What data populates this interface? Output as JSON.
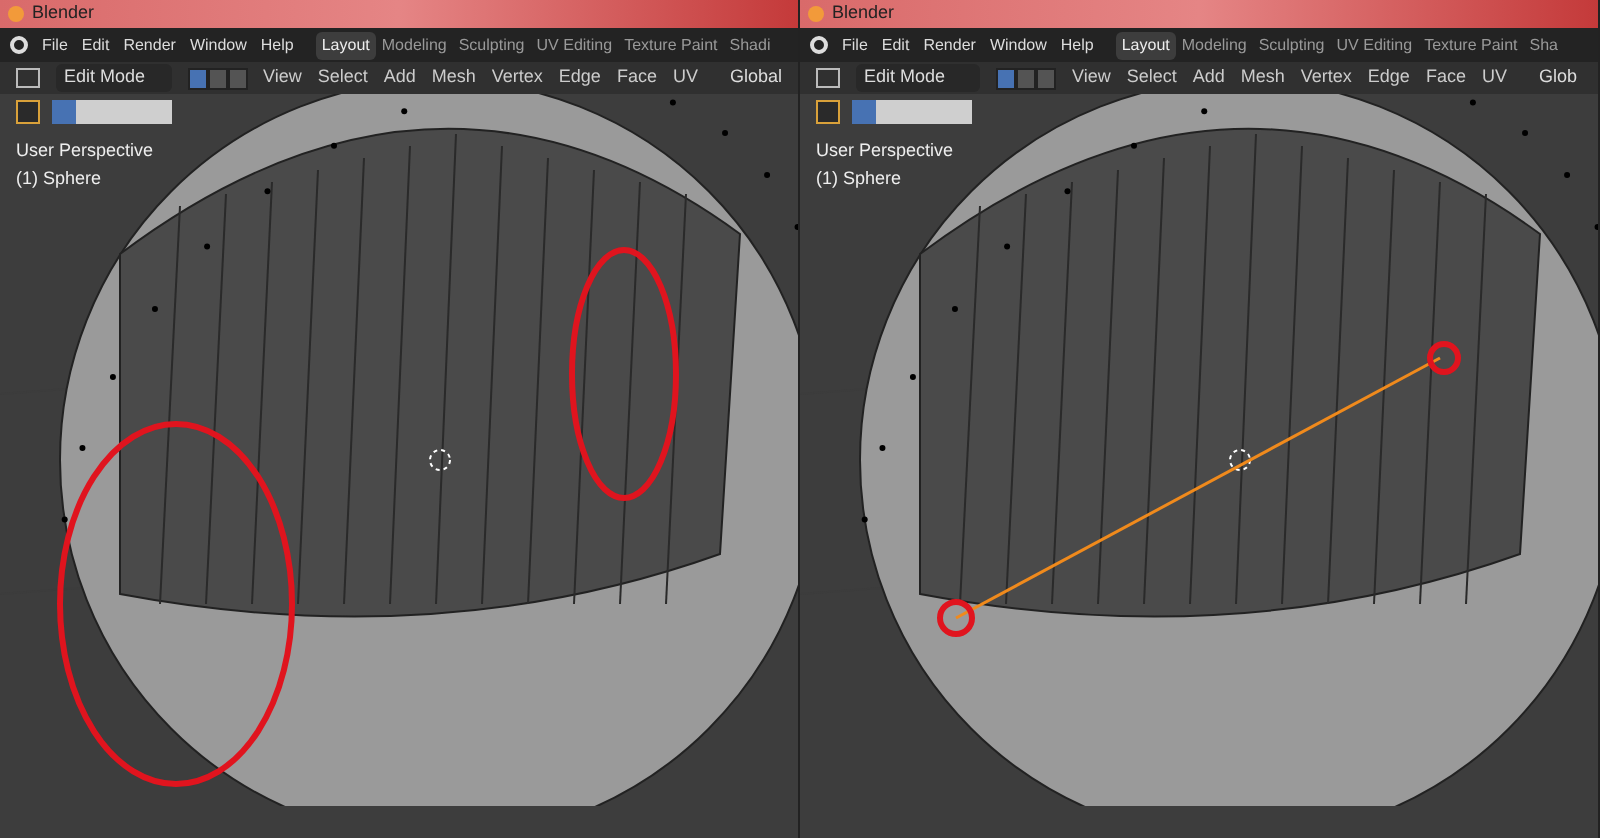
{
  "panels": [
    {
      "title": "Blender",
      "menus": [
        "File",
        "Edit",
        "Render",
        "Window",
        "Help"
      ],
      "workspaces": [
        {
          "label": "Layout",
          "selected": true
        },
        {
          "label": "Modeling",
          "selected": false
        },
        {
          "label": "Sculpting",
          "selected": false
        },
        {
          "label": "UV Editing",
          "selected": false
        },
        {
          "label": "Texture Paint",
          "selected": false
        },
        {
          "label": "Shadi",
          "selected": false
        }
      ],
      "mode": "Edit Mode",
      "select_modes": [
        {
          "selected": true
        },
        {
          "selected": false
        },
        {
          "selected": false
        }
      ],
      "header_menus": [
        "View",
        "Select",
        "Add",
        "Mesh",
        "Vertex",
        "Edge",
        "Face",
        "UV"
      ],
      "orientation": "Global",
      "view_name": "User Perspective",
      "object_name": "(1) Sphere",
      "kind": "ellipses"
    },
    {
      "title": "Blender",
      "menus": [
        "File",
        "Edit",
        "Render",
        "Window",
        "Help"
      ],
      "workspaces": [
        {
          "label": "Layout",
          "selected": true
        },
        {
          "label": "Modeling",
          "selected": false
        },
        {
          "label": "Sculpting",
          "selected": false
        },
        {
          "label": "UV Editing",
          "selected": false
        },
        {
          "label": "Texture Paint",
          "selected": false
        },
        {
          "label": "Sha",
          "selected": false
        }
      ],
      "mode": "Edit Mode",
      "select_modes": [
        {
          "selected": true
        },
        {
          "selected": false
        },
        {
          "selected": false
        }
      ],
      "header_menus": [
        "View",
        "Select",
        "Add",
        "Mesh",
        "Vertex",
        "Edge",
        "Face",
        "UV"
      ],
      "orientation": "Glob",
      "view_name": "User Perspective",
      "object_name": "(1) Sphere",
      "kind": "points"
    }
  ]
}
